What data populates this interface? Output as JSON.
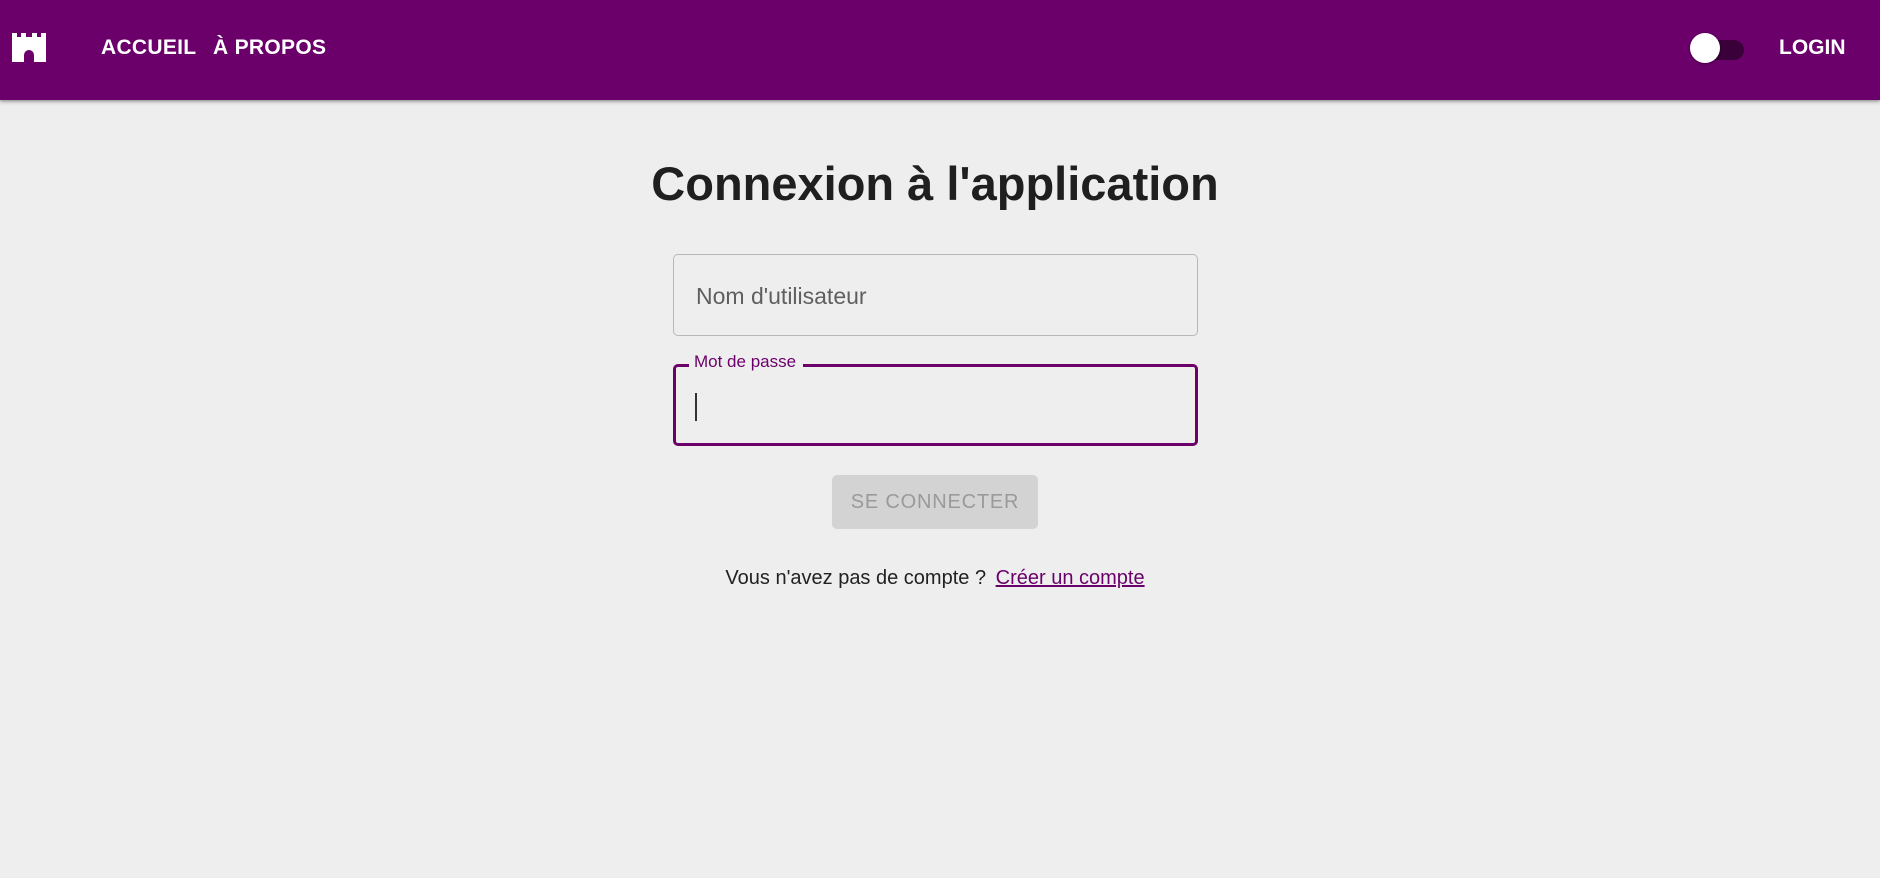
{
  "appbar": {
    "logo_icon": "castle-icon",
    "nav": [
      {
        "label": "ACCUEIL"
      },
      {
        "label": "À PROPOS"
      }
    ],
    "theme_toggle": {
      "icon": "toggle-switch",
      "on": false
    },
    "login_label": "LOGIN",
    "color": "#6b006b"
  },
  "main": {
    "title": "Connexion à l'application",
    "username": {
      "placeholder": "Nom d'utilisateur",
      "value": ""
    },
    "password": {
      "label": "Mot de passe",
      "value": ""
    },
    "submit_label": "SE CONNECTER",
    "register_prompt": "Vous n'avez pas de compte ?",
    "register_link": "Créer un compte"
  }
}
